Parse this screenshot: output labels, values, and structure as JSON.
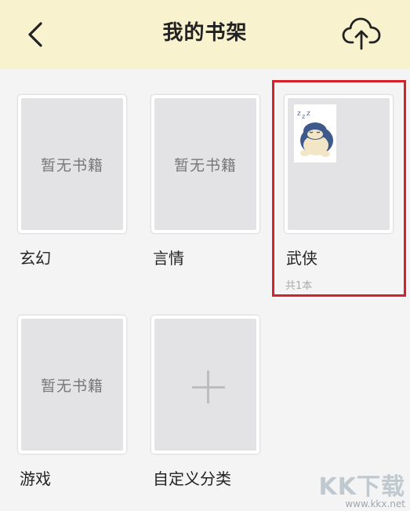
{
  "header": {
    "title": "我的书架"
  },
  "shelf": {
    "empty_text": "暂无书籍",
    "categories": [
      {
        "name": "玄幻",
        "empty_label": "暂无书籍"
      },
      {
        "name": "言情",
        "empty_label": "暂无书籍"
      },
      {
        "name": "武侠",
        "count": "共1本"
      },
      {
        "name": "游戏",
        "empty_label": "暂无书籍"
      },
      {
        "name": "自定义分类"
      }
    ]
  },
  "colors": {
    "header_bg": "#f8f2cf",
    "highlight_border": "#d6202a",
    "cover_bg": "#e3e3e5"
  },
  "icons": {
    "back": "chevron-left-icon",
    "upload": "cloud-upload-icon",
    "add": "plus-icon"
  },
  "watermark": {
    "logo": "KK下载",
    "url": "www.kkx.net"
  }
}
